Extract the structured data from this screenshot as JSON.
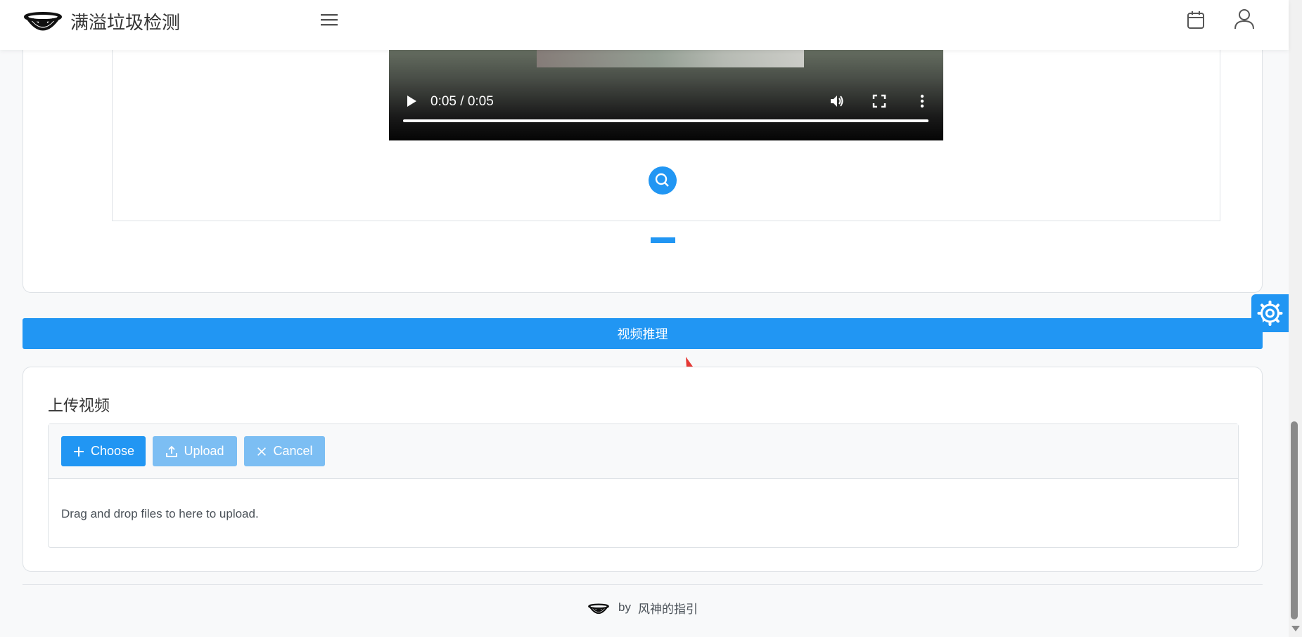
{
  "header": {
    "app_title": "满溢垃圾检测",
    "icons": [
      "logo",
      "menu-icon",
      "calendar-icon",
      "user-icon"
    ]
  },
  "video": {
    "time_display": "0:05 / 0:05",
    "progress_fraction": 1.0
  },
  "carousel": {
    "indicator_count": 1,
    "active_index": 0
  },
  "actions": {
    "inference_label": "视频推理"
  },
  "upload": {
    "title": "上传视频",
    "choose_label": "Choose",
    "upload_label": "Upload",
    "cancel_label": "Cancel",
    "drop_hint": "Drag and drop files to here to upload."
  },
  "footer": {
    "by": "by",
    "author": "风神的指引"
  },
  "colors": {
    "primary": "#2196f3",
    "primary_disabled": "#7cbef3",
    "annotation_arrow": "#e53935"
  }
}
